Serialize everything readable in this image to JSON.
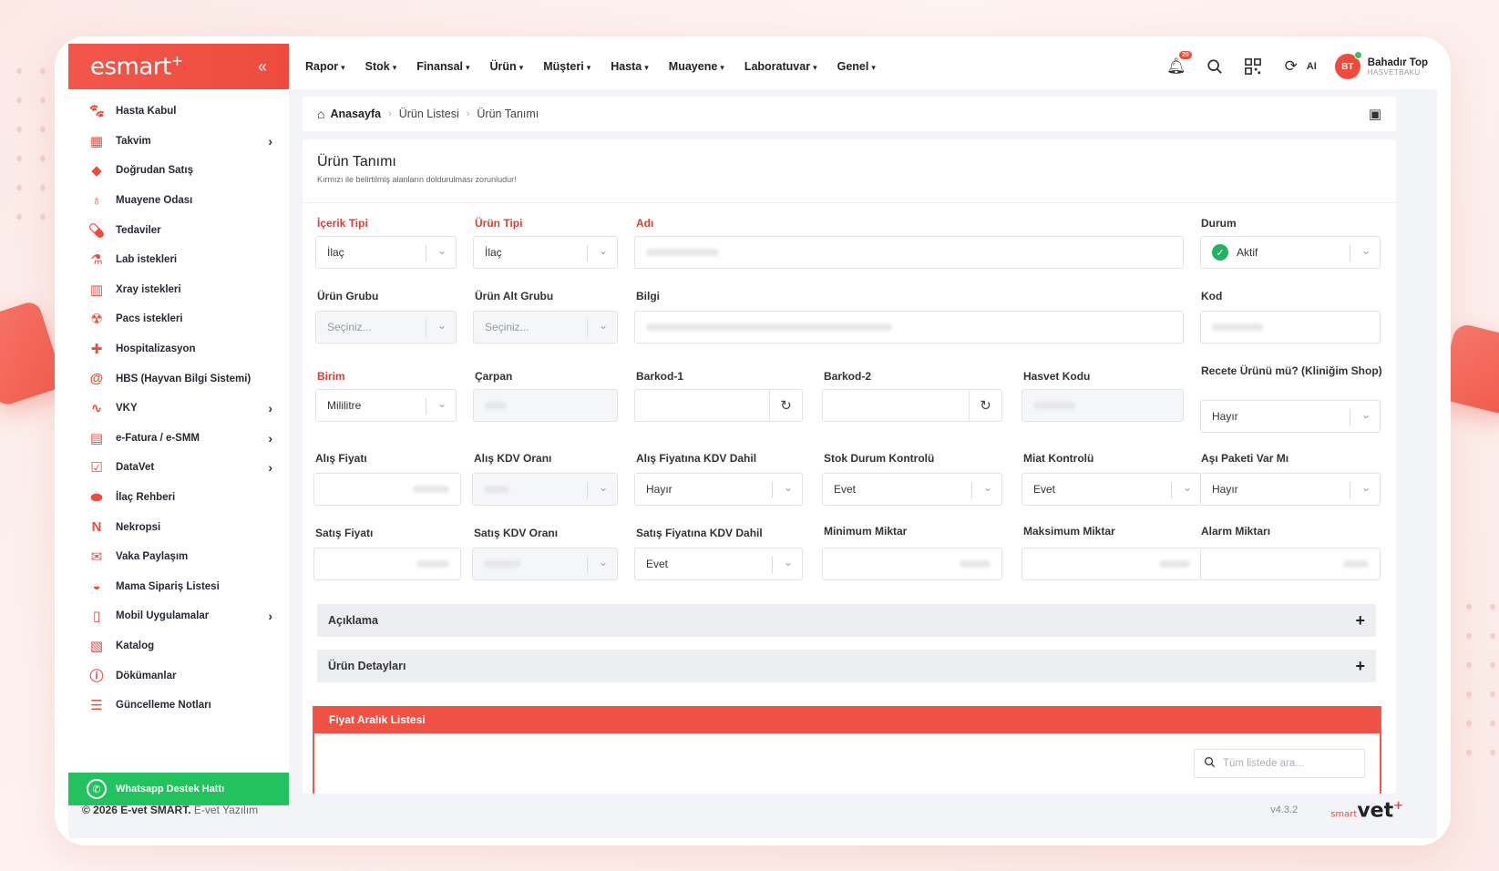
{
  "brand": {
    "logo_text": "esmart",
    "logo_plus": "+",
    "collapse_icon": "chevrons-left-icon"
  },
  "sidebar": {
    "items": [
      {
        "label": "Hasta Kabul",
        "icon": "paw-icon",
        "has_submenu": false
      },
      {
        "label": "Takvim",
        "icon": "calendar-icon",
        "has_submenu": true
      },
      {
        "label": "Doğrudan Satış",
        "icon": "tag-icon",
        "has_submenu": false
      },
      {
        "label": "Muayene Odası",
        "icon": "stethoscope-icon",
        "has_submenu": false
      },
      {
        "label": "Tedaviler",
        "icon": "pills-icon",
        "has_submenu": false
      },
      {
        "label": "Lab istekleri",
        "icon": "flask-icon",
        "has_submenu": false
      },
      {
        "label": "Xray istekleri",
        "icon": "building-icon",
        "has_submenu": false
      },
      {
        "label": "Pacs istekleri",
        "icon": "radiation-icon",
        "has_submenu": false
      },
      {
        "label": "Hospitalizasyon",
        "icon": "medkit-icon",
        "has_submenu": false
      },
      {
        "label": "HBS (Hayvan Bilgi Sistemi)",
        "icon": "at-icon",
        "has_submenu": false
      },
      {
        "label": "VKY",
        "icon": "chart-line-icon",
        "has_submenu": true
      },
      {
        "label": "e-Fatura / e-SMM",
        "icon": "invoice-icon",
        "has_submenu": true
      },
      {
        "label": "DataVet",
        "icon": "check-square-icon",
        "has_submenu": true
      },
      {
        "label": "İlaç Rehberi",
        "icon": "capsules-icon",
        "has_submenu": false
      },
      {
        "label": "Nekropsi",
        "icon": "letter-n-icon",
        "has_submenu": false
      },
      {
        "label": "Vaka Paylaşım",
        "icon": "comments-icon",
        "has_submenu": false
      },
      {
        "label": "Mama Sipariş Listesi",
        "icon": "bowl-icon",
        "has_submenu": false
      },
      {
        "label": "Mobil Uygulamalar",
        "icon": "tablet-icon",
        "has_submenu": true
      },
      {
        "label": "Katalog",
        "icon": "catalog-icon",
        "has_submenu": false
      },
      {
        "label": "Dökümanlar",
        "icon": "info-icon",
        "has_submenu": false
      },
      {
        "label": "Güncelleme Notları",
        "icon": "list-icon",
        "has_submenu": false
      }
    ],
    "whatsapp_label": "Whatsapp Destek Hattı"
  },
  "topnav": [
    "Rapor",
    "Stok",
    "Finansal",
    "Ürün",
    "Müşteri",
    "Hasta",
    "Muayene",
    "Laboratuvar",
    "Genel"
  ],
  "topbar": {
    "notification_count": "20",
    "ai_label": "AI",
    "user_initials": "BT",
    "user_name": "Bahadır Top",
    "user_sub": "HASVETBAKU"
  },
  "breadcrumb": {
    "home": "Anasayfa",
    "level1": "Ürün Listesi",
    "current": "Ürün Tanımı"
  },
  "card": {
    "title": "Ürün Tanımı",
    "subtitle": "Kırmızı ile belirtilmiş alanların doldurulması zorunludur!"
  },
  "form": {
    "icerik_tipi": {
      "label": "İçerik Tipi",
      "value": "İlaç"
    },
    "urun_tipi": {
      "label": "Ürün Tipi",
      "value": "İlaç"
    },
    "adi": {
      "label": "Adı"
    },
    "durum": {
      "label": "Durum",
      "value": "Aktif"
    },
    "urun_grubu": {
      "label": "Ürün Grubu",
      "placeholder": "Seçiniz..."
    },
    "urun_alt_grubu": {
      "label": "Ürün Alt Grubu",
      "placeholder": "Seçiniz..."
    },
    "bilgi": {
      "label": "Bilgi"
    },
    "kod": {
      "label": "Kod"
    },
    "birim": {
      "label": "Birim",
      "value": "Mililitre"
    },
    "carpan": {
      "label": "Çarpan"
    },
    "barkod1": {
      "label": "Barkod-1"
    },
    "barkod2": {
      "label": "Barkod-2"
    },
    "hasvet_kodu": {
      "label": "Hasvet Kodu"
    },
    "recete": {
      "label": "Recete Ürünü mü? (Kliniğim Shop)",
      "value": "Hayır"
    },
    "alis_fiyati": {
      "label": "Alış Fiyatı"
    },
    "alis_kdv": {
      "label": "Alış KDV Oranı"
    },
    "alis_kdv_dahil": {
      "label": "Alış Fiyatına KDV Dahil",
      "value": "Hayır"
    },
    "stok_durum": {
      "label": "Stok Durum Kontrolü",
      "value": "Evet"
    },
    "miat": {
      "label": "Miat Kontrolü",
      "value": "Evet"
    },
    "asi_paketi": {
      "label": "Aşı Paketi Var Mı",
      "value": "Hayır"
    },
    "satis_fiyati": {
      "label": "Satış Fiyatı"
    },
    "satis_kdv": {
      "label": "Satış KDV Oranı"
    },
    "satis_kdv_dahil": {
      "label": "Satış Fiyatına KDV Dahil",
      "value": "Evet"
    },
    "min_miktar": {
      "label": "Minimum Miktar"
    },
    "max_miktar": {
      "label": "Maksimum Miktar"
    },
    "alarm_miktar": {
      "label": "Alarm Miktarı"
    }
  },
  "accordions": {
    "aciklama": "Açıklama",
    "urun_detaylari": "Ürün Detayları"
  },
  "fiyat_panel": {
    "title": "Fiyat Aralık Listesi",
    "search_placeholder": "Tüm listede ara..."
  },
  "footer": {
    "copyright_year": "© 2026 E-vet SMART.",
    "company": "E-vet Yazılım",
    "version": "v4.3.2",
    "logo_small": "smart",
    "logo_main": "vet",
    "logo_plus": "+"
  },
  "colors": {
    "brand": "#ef4a3c",
    "whatsapp": "#22c35e",
    "active": "#22b35e"
  }
}
